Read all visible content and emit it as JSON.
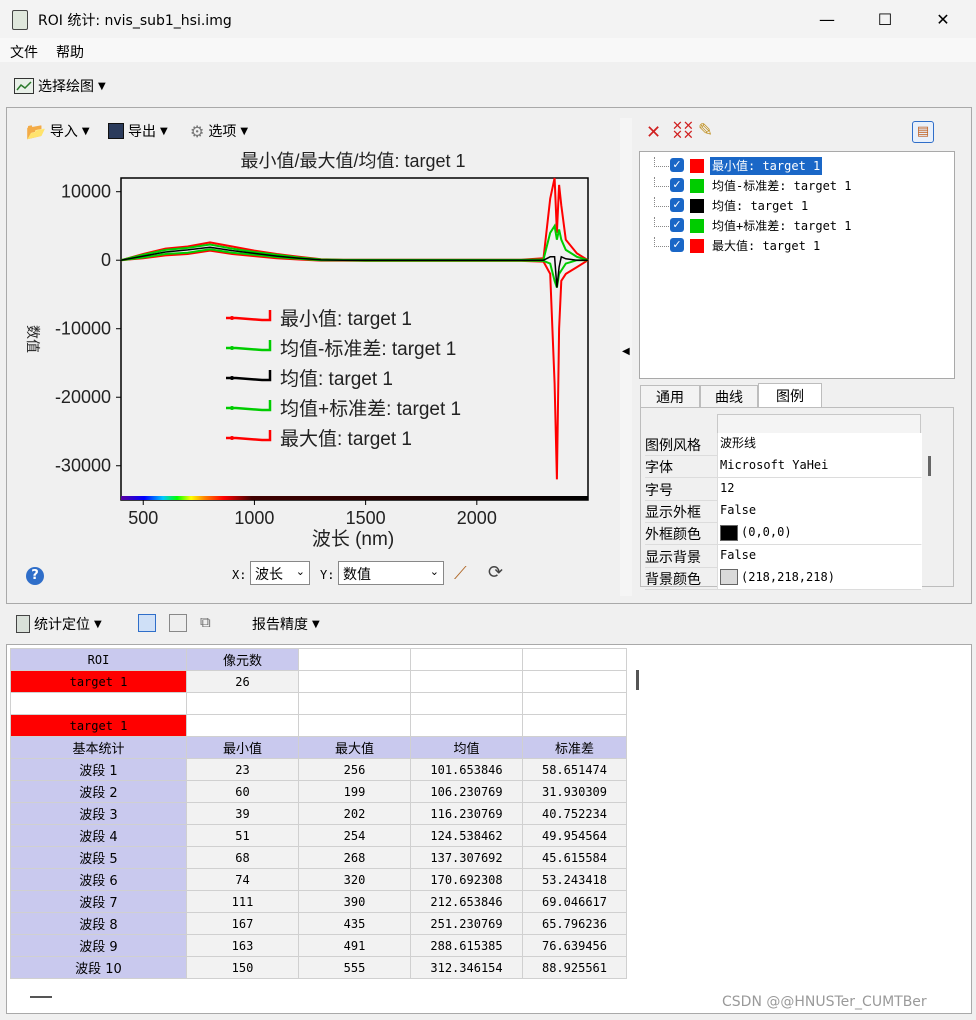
{
  "window": {
    "title": "ROI 统计: nvis_sub1_hsi.img",
    "minimize": "—",
    "maximize": "☐",
    "close": "✕"
  },
  "menu": {
    "file": "文件",
    "help": "帮助"
  },
  "toolbar": {
    "select_plot": "选择绘图",
    "import": "导入",
    "export": "导出",
    "options": "选项"
  },
  "chart": {
    "title": "最小值/最大值/均值: target 1",
    "xlabel": "波长 (nm)",
    "ylabel": "数值",
    "yticks": [
      "10000",
      "0",
      "-10000",
      "-20000",
      "-30000"
    ],
    "xticks": [
      "500",
      "1000",
      "1500",
      "2000"
    ],
    "legend": [
      "最小值: target 1",
      "均值-标准差: target 1",
      "均值: target 1",
      "均值+标准差: target 1",
      "最大值: target 1"
    ],
    "colors": {
      "min": "#ff0000",
      "mean_minus": "#00cc00",
      "mean": "#000000",
      "mean_plus": "#00cc00",
      "max": "#ff0000"
    }
  },
  "chart_data": {
    "type": "line",
    "title": "最小值/最大值/均值: target 1",
    "xlabel": "波长 (nm)",
    "ylabel": "数值",
    "xlim": [
      400,
      2500
    ],
    "ylim": [
      -35000,
      12000
    ],
    "grid": false,
    "legend_position": "center",
    "x": [
      400,
      500,
      600,
      700,
      800,
      900,
      1000,
      1100,
      1200,
      1300,
      1400,
      1500,
      1600,
      1700,
      1800,
      1900,
      2000,
      2100,
      2200,
      2300,
      2330,
      2350,
      2360,
      2370,
      2380,
      2400,
      2450,
      2500
    ],
    "series": [
      {
        "name": "最小值: target 1",
        "values": [
          0,
          300,
          700,
          900,
          1400,
          900,
          600,
          300,
          100,
          -50,
          -50,
          -100,
          -100,
          -100,
          -100,
          -100,
          -100,
          -100,
          -100,
          -200,
          -2000,
          -18000,
          -32000,
          -10000,
          -3000,
          -2000,
          -1000,
          0
        ]
      },
      {
        "name": "均值-标准差: target 1",
        "values": [
          0,
          400,
          900,
          1100,
          1600,
          1100,
          800,
          450,
          200,
          0,
          -20,
          -50,
          -50,
          -50,
          -50,
          -50,
          -50,
          -50,
          -50,
          -100,
          -500,
          -3000,
          -4000,
          -2000,
          -1500,
          -500,
          0,
          0
        ]
      },
      {
        "name": "均值: target 1",
        "values": [
          0,
          600,
          1200,
          1500,
          1900,
          1400,
          1000,
          600,
          300,
          50,
          0,
          0,
          0,
          0,
          0,
          0,
          0,
          0,
          0,
          0,
          500,
          500,
          -4000,
          -1000,
          500,
          200,
          0,
          0
        ]
      },
      {
        "name": "均值+标准差: target 1",
        "values": [
          0,
          800,
          1500,
          1800,
          2300,
          1700,
          1200,
          800,
          400,
          100,
          50,
          50,
          50,
          50,
          50,
          50,
          50,
          50,
          50,
          100,
          4000,
          5000,
          3000,
          4500,
          3000,
          1500,
          500,
          0
        ]
      },
      {
        "name": "最大值: target 1",
        "values": [
          0,
          900,
          1700,
          2000,
          2600,
          2000,
          1400,
          900,
          500,
          150,
          80,
          80,
          80,
          80,
          80,
          80,
          80,
          80,
          80,
          300,
          9000,
          12000,
          4000,
          11000,
          8000,
          3000,
          1000,
          0
        ]
      }
    ]
  },
  "bottom_controls": {
    "x_label": "X:",
    "x_value": "波长",
    "y_label": "Y:",
    "y_value": "数值"
  },
  "legend_tree": [
    {
      "label": "最小值: target 1",
      "color": "#ff0000",
      "selected": true
    },
    {
      "label": "均值-标准差: target 1",
      "color": "#00cc00",
      "selected": false
    },
    {
      "label": "均值: target 1",
      "color": "#000000",
      "selected": false
    },
    {
      "label": "均值+标准差: target 1",
      "color": "#00cc00",
      "selected": false
    },
    {
      "label": "最大值: target 1",
      "color": "#ff0000",
      "selected": false
    }
  ],
  "tabs": [
    "通用",
    "曲线",
    "图例"
  ],
  "properties": [
    {
      "key": "图例风格",
      "value": "波形线"
    },
    {
      "key": "字体",
      "value": "Microsoft YaHei"
    },
    {
      "key": "字号",
      "value": "12"
    },
    {
      "key": "显示外框",
      "value": "False"
    },
    {
      "key": "外框颜色",
      "value": "(0,0,0)",
      "swatch": "#000000"
    },
    {
      "key": "显示背景",
      "value": "False"
    },
    {
      "key": "背景颜色",
      "value": "(218,218,218)",
      "swatch": "#dadada"
    }
  ],
  "stats_toolbar": {
    "locate": "统计定位",
    "precision": "报告精度"
  },
  "stats": {
    "roi_header": "ROI",
    "pixels_header": "像元数",
    "roi_name": "target 1",
    "pixel_count": "26",
    "section_name": "target 1",
    "headers": [
      "基本统计",
      "最小值",
      "最大值",
      "均值",
      "标准差"
    ],
    "rows": [
      [
        "波段 1",
        "23",
        "256",
        "101.653846",
        "58.651474"
      ],
      [
        "波段 2",
        "60",
        "199",
        "106.230769",
        "31.930309"
      ],
      [
        "波段 3",
        "39",
        "202",
        "116.230769",
        "40.752234"
      ],
      [
        "波段 4",
        "51",
        "254",
        "124.538462",
        "49.954564"
      ],
      [
        "波段 5",
        "68",
        "268",
        "137.307692",
        "45.615584"
      ],
      [
        "波段 6",
        "74",
        "320",
        "170.692308",
        "53.243418"
      ],
      [
        "波段 7",
        "111",
        "390",
        "212.653846",
        "69.046617"
      ],
      [
        "波段 8",
        "167",
        "435",
        "251.230769",
        "65.796236"
      ],
      [
        "波段 9",
        "163",
        "491",
        "288.615385",
        "76.639456"
      ],
      [
        "波段 10",
        "150",
        "555",
        "312.346154",
        "88.925561"
      ]
    ]
  },
  "watermark": "CSDN @@HNUSTer_CUMTBer"
}
